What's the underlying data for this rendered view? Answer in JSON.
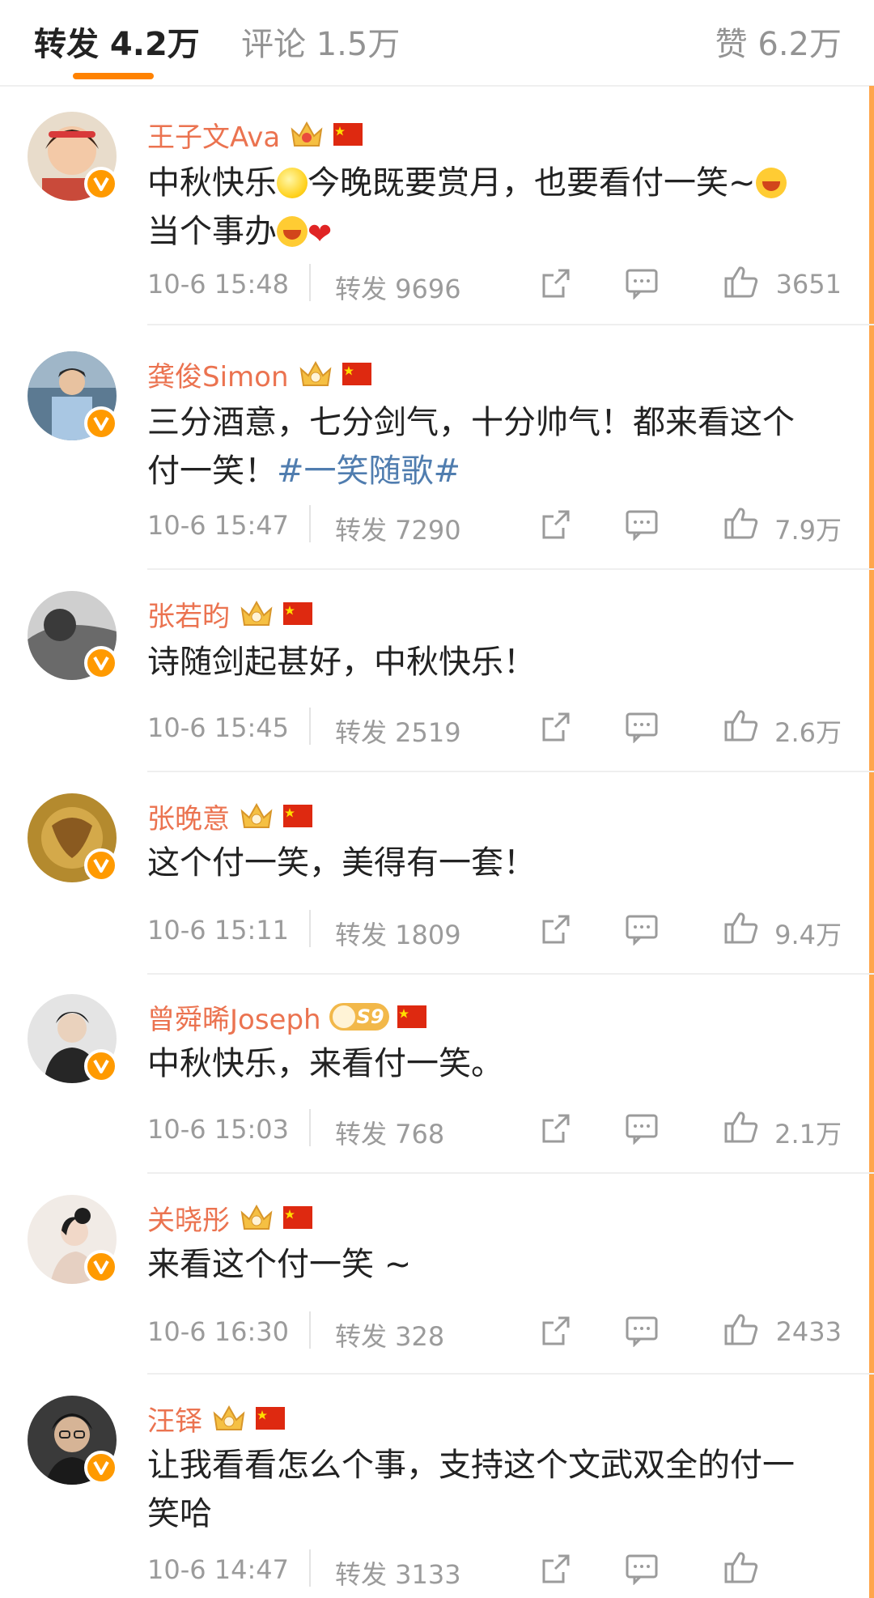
{
  "tabs": {
    "repost": "转发 4.2万",
    "comment": "评论 1.5万",
    "like": "赞 6.2万"
  },
  "posts": [
    {
      "name": "王子文Ava",
      "text": [
        "中秋快乐",
        "今晚既要赏月，也要看付一笑~",
        "当个事办"
      ],
      "time": "10-6 15:48",
      "repost": "转发 9696",
      "likes": "3651"
    },
    {
      "name": "龚俊Simon",
      "text": [
        "三分酒意，七分剑气，十分帅气！都来看这个付一笑！"
      ],
      "topic": "#一笑随歌#",
      "time": "10-6 15:47",
      "repost": "转发 7290",
      "likes": "7.9万"
    },
    {
      "name": "张若昀",
      "text": [
        "诗随剑起甚好，中秋快乐！"
      ],
      "time": "10-6 15:45",
      "repost": "转发 2519",
      "likes": "2.6万"
    },
    {
      "name": "张晚意",
      "text": [
        "这个付一笑，美得有一套！"
      ],
      "time": "10-6 15:11",
      "repost": "转发 1809",
      "likes": "9.4万"
    },
    {
      "name": "曾舜晞Joseph",
      "badge": "S9",
      "text": [
        "中秋快乐，来看付一笑。"
      ],
      "time": "10-6 15:03",
      "repost": "转发 768",
      "likes": "2.1万"
    },
    {
      "name": "关晓彤",
      "text": [
        "来看这个付一笑 ~"
      ],
      "time": "10-6 16:30",
      "repost": "转发 328",
      "likes": "2433"
    },
    {
      "name": "汪铎",
      "text": [
        "让我看看怎么个事，支持这个文武双全的付一笑哈"
      ],
      "time": "10-6 14:47",
      "repost": "转发 3133",
      "likes": ""
    }
  ],
  "icons": {
    "share": "share-icon",
    "comment": "comment-icon",
    "like": "thumbs-up-icon",
    "verified": "verified-v-icon",
    "crown": "crown-icon",
    "flag": "china-flag-icon"
  },
  "colors": {
    "accent": "#ff8200",
    "username": "#eb7350",
    "topic": "#507daf",
    "meta": "#9b9b9b",
    "verified": "#ff9a00"
  }
}
